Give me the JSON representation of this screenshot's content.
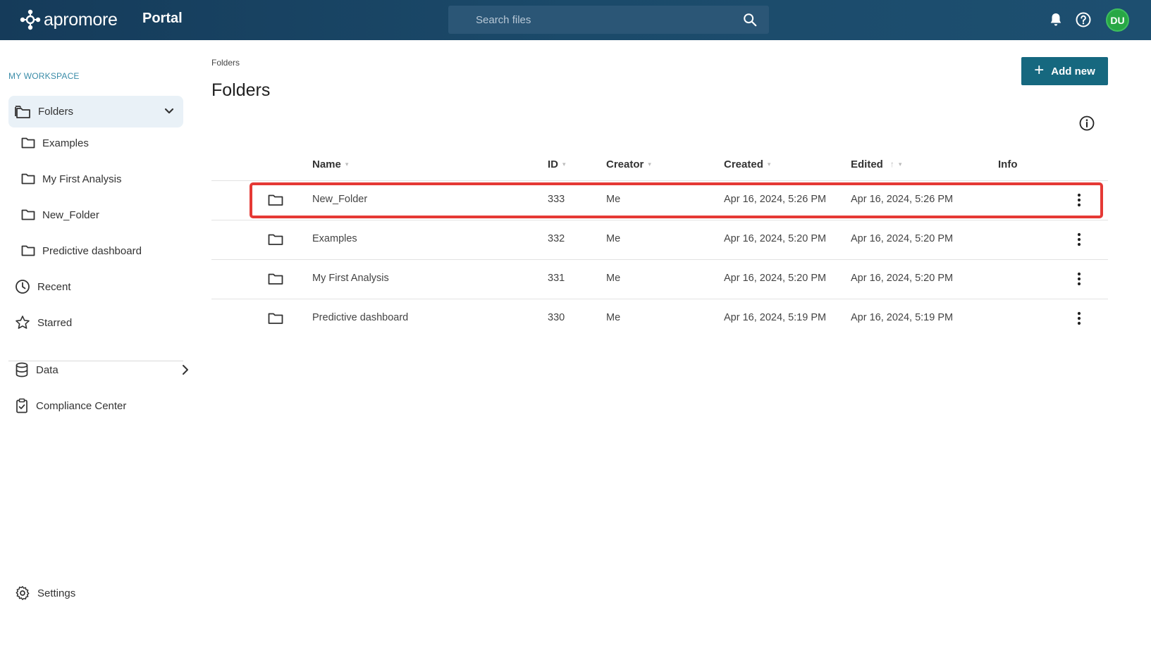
{
  "header": {
    "logo_text": "apromore",
    "portal_label": "Portal",
    "search_placeholder": "Search files",
    "avatar_initials": "DU",
    "icons": [
      "search-icon",
      "bell-icon",
      "help-icon"
    ]
  },
  "sidebar": {
    "workspace_label": "MY WORKSPACE",
    "folders_label": "Folders",
    "subfolders": [
      {
        "label": "Examples"
      },
      {
        "label": "My First Analysis"
      },
      {
        "label": "New_Folder"
      },
      {
        "label": "Predictive dashboard"
      }
    ],
    "recent_label": "Recent",
    "starred_label": "Starred",
    "data_label": "Data",
    "compliance_label": "Compliance Center",
    "settings_label": "Settings"
  },
  "main": {
    "breadcrumb": "Folders",
    "title": "Folders",
    "add_button_label": "Add new",
    "columns": {
      "name": "Name",
      "id": "ID",
      "creator": "Creator",
      "created": "Created",
      "edited": "Edited",
      "info": "Info"
    },
    "rows": [
      {
        "name": "New_Folder",
        "id": "333",
        "creator": "Me",
        "created": "Apr 16, 2024, 5:26 PM",
        "edited": "Apr 16, 2024, 5:26 PM"
      },
      {
        "name": "Examples",
        "id": "332",
        "creator": "Me",
        "created": "Apr 16, 2024, 5:20 PM",
        "edited": "Apr 16, 2024, 5:20 PM"
      },
      {
        "name": "My First Analysis",
        "id": "331",
        "creator": "Me",
        "created": "Apr 16, 2024, 5:20 PM",
        "edited": "Apr 16, 2024, 5:20 PM"
      },
      {
        "name": "Predictive dashboard",
        "id": "330",
        "creator": "Me",
        "created": "Apr 16, 2024, 5:19 PM",
        "edited": "Apr 16, 2024, 5:19 PM"
      }
    ],
    "highlighted_row": "New_Folder"
  },
  "colors": {
    "topbar": "#1b4a6a",
    "accent": "#16687f",
    "workspace_label": "#3a8ca8",
    "avatar": "#28a745",
    "highlight": "#e53935",
    "active_item_bg": "#e9f1f7"
  }
}
